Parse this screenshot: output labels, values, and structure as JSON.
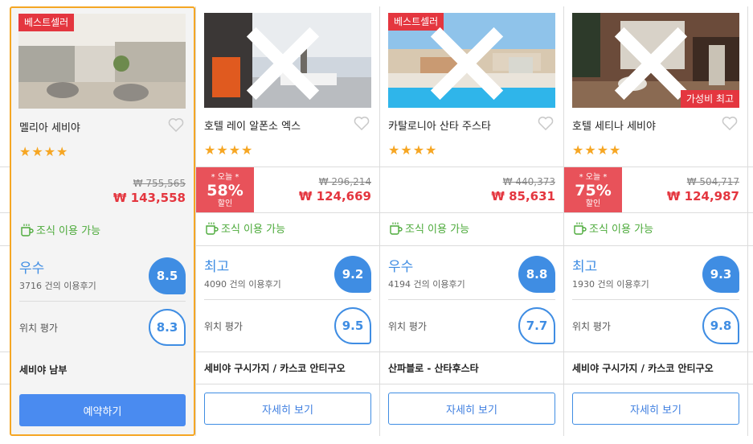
{
  "labels": {
    "bestseller": "베스트셀러",
    "value_best": "가성비 최고",
    "today": "* 오늘 *",
    "discount_suffix": "할인",
    "breakfast": "조식 이용 가능",
    "location": "위치 평가",
    "book": "예약하기",
    "details": "자세히 보기"
  },
  "colors": {
    "accent": "#3f8de3",
    "price_red": "#e4363f",
    "selected_border": "#f5a623",
    "breakfast_green": "#4caa3a"
  },
  "hotels": [
    {
      "name": "멜리아 세비야",
      "stars": "★★★★",
      "old_price": "₩ 755,565",
      "new_price": "₩ 143,558",
      "grade": "우수",
      "reviews": "3716 건의 이용후기",
      "score": "8.5",
      "location_score": "8.3",
      "area": "세비야 남부",
      "bestseller": true,
      "selected": true
    },
    {
      "name": "호텔 레이 알폰소 엑스",
      "stars": "★★★★",
      "discount": "58%",
      "old_price": "₩ 296,214",
      "new_price": "₩ 124,669",
      "grade": "최고",
      "reviews": "4090 건의 이용후기",
      "score": "9.2",
      "location_score": "9.5",
      "area": "세비야 구시가지 / 카스코 안티구오"
    },
    {
      "name": "카탈로니아 산타 주스타",
      "stars": "★★★★",
      "old_price": "₩ 440,373",
      "new_price": "₩ 85,631",
      "grade": "우수",
      "reviews": "4194 건의 이용후기",
      "score": "8.8",
      "location_score": "7.7",
      "area": "산파블로 - 산타후스타",
      "bestseller": true
    },
    {
      "name": "호텔 세티나 세비야",
      "stars": "★★★★",
      "discount": "75%",
      "old_price": "₩ 504,717",
      "new_price": "₩ 124,987",
      "grade": "최고",
      "reviews": "1930 건의 이용후기",
      "score": "9.3",
      "location_score": "9.8",
      "area": "세비야 구시가지 / 카스코 안티구오",
      "value_best": true
    }
  ]
}
